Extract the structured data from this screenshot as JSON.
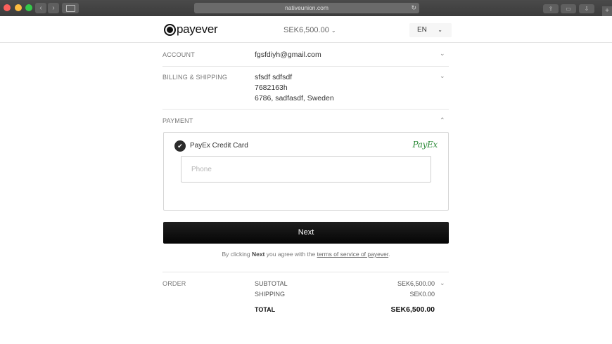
{
  "browser": {
    "url": "nativeunion.com"
  },
  "header": {
    "logo_text": "payever",
    "price": "SEK6,500.00",
    "language": "EN"
  },
  "account": {
    "label": "ACCOUNT",
    "email": "fgsfdiyh@gmail.com"
  },
  "billing": {
    "label": "BILLING & SHIPPING",
    "name": "sfsdf sdfsdf",
    "phone": "7682163h",
    "address": "6786, sadfasdf, Sweden"
  },
  "payment": {
    "label": "PAYMENT",
    "method_name": "PayEx Credit Card",
    "method_logo_text": "PayEx",
    "phone_placeholder": "Phone"
  },
  "next_button": {
    "label": "Next"
  },
  "terms": {
    "prefix": "By clicking ",
    "bold": "Next",
    "middle": " you agree with the ",
    "link": "terms of service of payever",
    "suffix": "."
  },
  "order": {
    "label": "ORDER",
    "subtotal_label": "SUBTOTAL",
    "subtotal_value": "SEK6,500.00",
    "shipping_label": "SHIPPING",
    "shipping_value": "SEK0.00",
    "total_label": "TOTAL",
    "total_value": "SEK6,500.00"
  },
  "colors": {
    "button_bg": "#111111",
    "payex_green": "#2e8b3a",
    "divider": "#e6e6e6"
  },
  "icons": [
    "back-icon",
    "forward-icon",
    "sidebar-icon",
    "reload-icon",
    "share-icon",
    "tabs-icon",
    "download-icon",
    "new-tab-icon",
    "chevron-down-icon",
    "chevron-up-icon",
    "checkmark-icon"
  ]
}
